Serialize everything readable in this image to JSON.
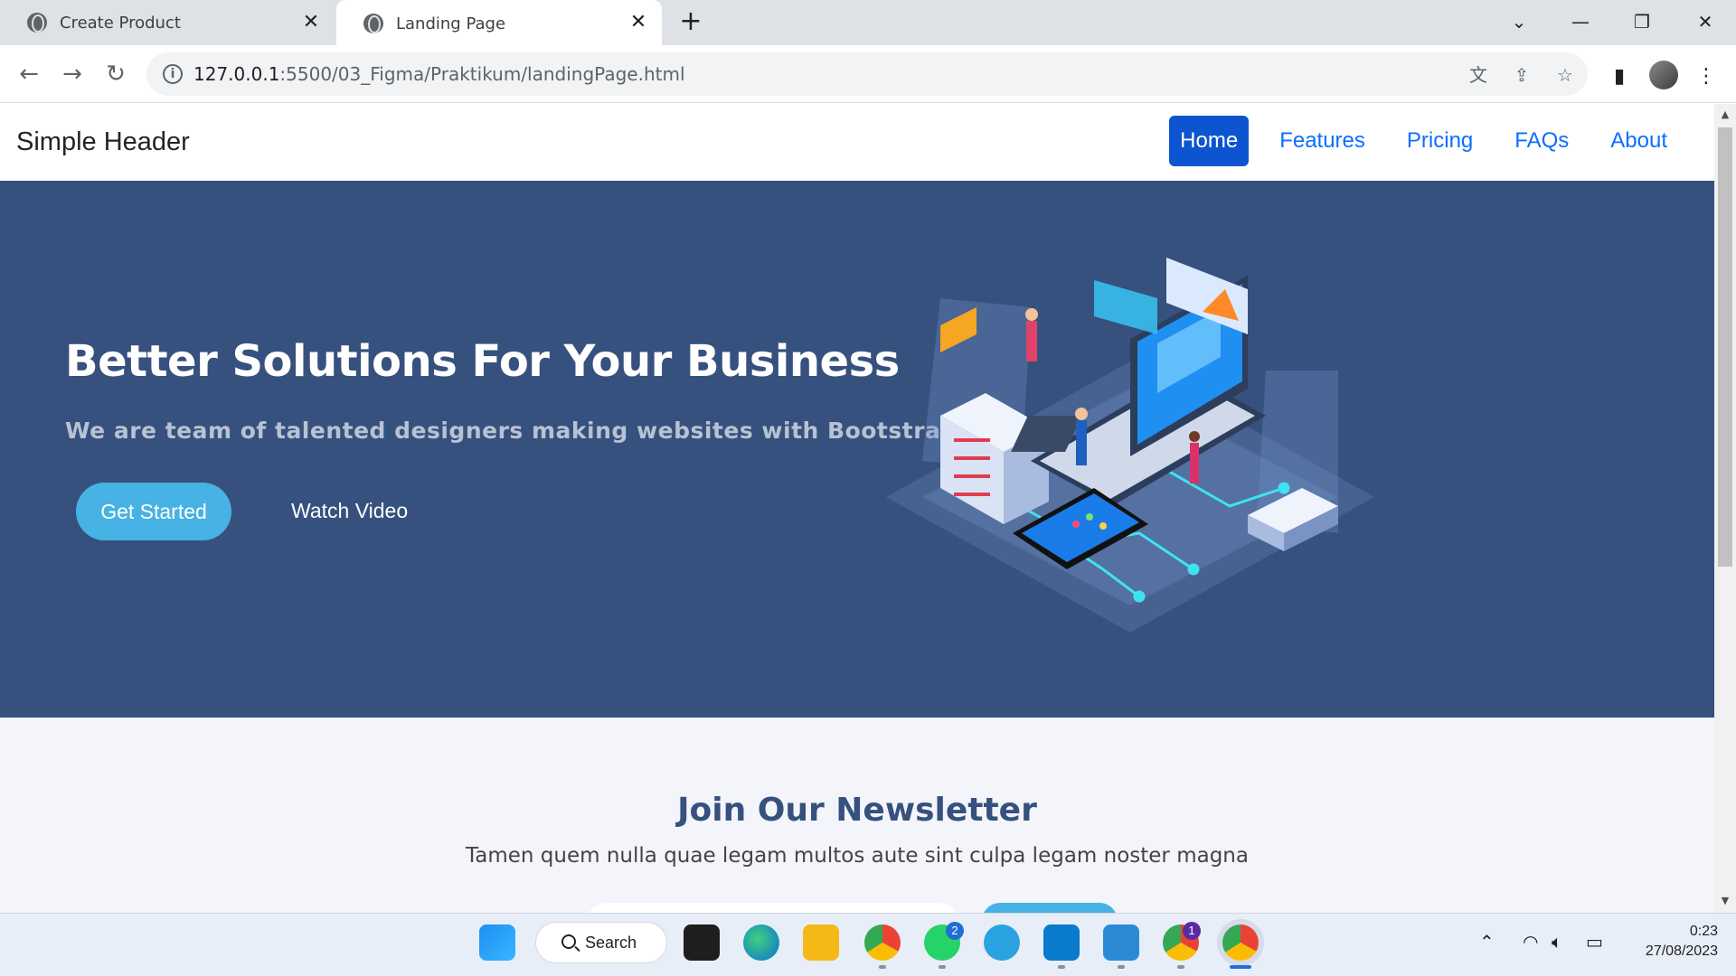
{
  "browser": {
    "tabs": [
      {
        "label": "Create Product"
      },
      {
        "label": "Landing Page"
      }
    ],
    "url_host": "127.0.0.1",
    "url_rest": ":5500/03_Figma/Praktikum/landingPage.html"
  },
  "site": {
    "brand": "Simple Header",
    "nav": [
      {
        "label": "Home",
        "active": true
      },
      {
        "label": "Features"
      },
      {
        "label": "Pricing"
      },
      {
        "label": "FAQs"
      },
      {
        "label": "About"
      }
    ],
    "hero": {
      "title": "Better Solutions For Your Business",
      "subtitle": "We are team of talented designers making websites with Bootstrap",
      "primary_button": "Get Started",
      "secondary_button": "Watch Video"
    },
    "newsletter": {
      "title": "Join Our Newsletter",
      "text": "Tamen quem nulla quae legam multos aute sint culpa legam noster magna"
    },
    "colors": {
      "hero_bg": "#37517e",
      "accent": "#47b2e4",
      "nav_active": "#0d55d0",
      "newsletter_bg": "#f3f5fa"
    }
  },
  "taskbar": {
    "search_label": "Search",
    "whatsapp_badge": "2",
    "chrome_badge": "1",
    "time": "0:23",
    "date": "27/08/2023"
  }
}
